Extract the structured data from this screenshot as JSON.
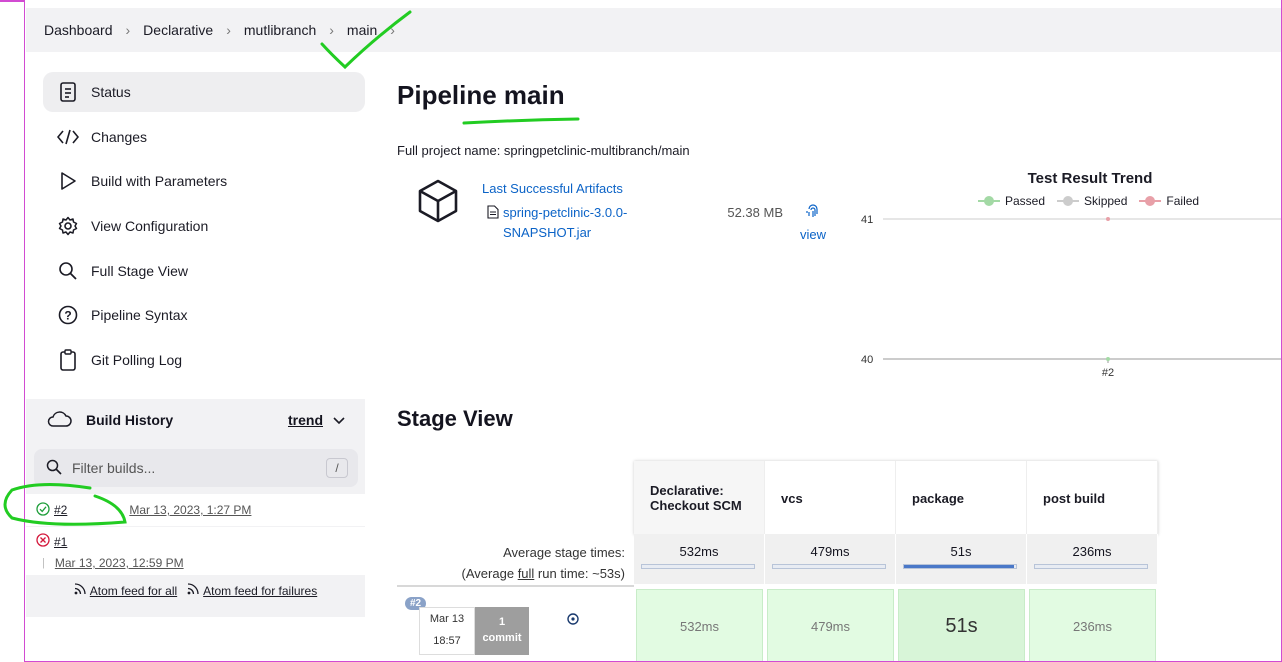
{
  "breadcrumb": [
    "Dashboard",
    "Declarative",
    "mutlibranch",
    "main"
  ],
  "sidebar": {
    "items": [
      {
        "label": "Status",
        "icon": "document-icon",
        "active": true
      },
      {
        "label": "Changes",
        "icon": "code-icon"
      },
      {
        "label": "Build with Parameters",
        "icon": "play-icon"
      },
      {
        "label": "View Configuration",
        "icon": "gear-icon"
      },
      {
        "label": "Full Stage View",
        "icon": "search-icon"
      },
      {
        "label": "Pipeline Syntax",
        "icon": "help-icon"
      },
      {
        "label": "Git Polling Log",
        "icon": "clipboard-icon"
      }
    ]
  },
  "build_history": {
    "title": "Build History",
    "trend_label": "trend",
    "filter_placeholder": "Filter builds...",
    "filter_shortcut": "/",
    "builds": [
      {
        "number": "#2",
        "date": "Mar 13, 2023, 1:27 PM",
        "status": "success"
      },
      {
        "number": "#1",
        "date": "Mar 13, 2023, 12:59 PM",
        "status": "failed"
      }
    ],
    "atom_all": "Atom feed for all",
    "atom_failures": "Atom feed for failures"
  },
  "main": {
    "title": "Pipeline main",
    "full_name": "Full project name: springpetclinic-multibranch/main",
    "artifacts": {
      "title": "Last Successful Artifacts",
      "file_name": "spring-petclinic-3.0.0-SNAPSHOT.jar",
      "size": "52.38 MB",
      "view_label": "view"
    },
    "stage_view_title": "Stage View"
  },
  "chart_data": {
    "type": "line",
    "title": "Test Result Trend",
    "legend": [
      "Passed",
      "Skipped",
      "Failed"
    ],
    "colors": {
      "passed": "#a3d9a5",
      "skipped": "#cccccc",
      "failed": "#e8a0a8"
    },
    "x": [
      "#2"
    ],
    "ylim": [
      40,
      41
    ],
    "yticks": [
      "41",
      "40"
    ],
    "series": [
      {
        "name": "Passed",
        "values": [
          0
        ]
      },
      {
        "name": "Skipped",
        "values": [
          0
        ]
      },
      {
        "name": "Failed",
        "values": [
          41
        ]
      }
    ]
  },
  "stage_view": {
    "stages": [
      "Declarative: Checkout SCM",
      "vcs",
      "package",
      "post build"
    ],
    "avg_label": "Average stage times:",
    "avg_full_prefix": "(Average ",
    "avg_full_link": "full",
    "avg_full_suffix": " run time: ~53s)",
    "avg_times": [
      "532ms",
      "479ms",
      "51s",
      "236ms"
    ],
    "avg_progress": [
      0,
      0,
      0.98,
      0
    ],
    "runs": [
      {
        "badge": "#2",
        "date": "Mar 13",
        "time": "18:57",
        "commit_count": "1",
        "commit_label": "commit",
        "times": [
          "532ms",
          "479ms",
          "51s",
          "236ms"
        ]
      }
    ]
  }
}
